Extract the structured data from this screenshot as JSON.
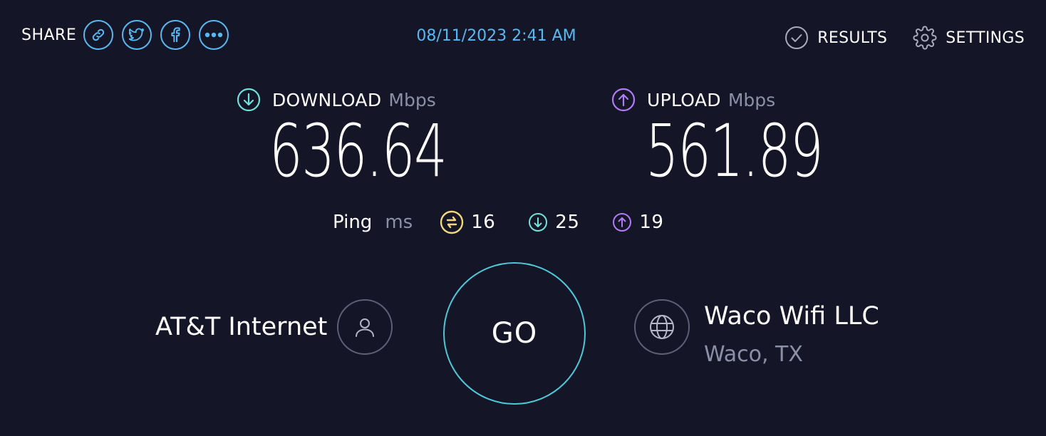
{
  "header": {
    "share_label": "SHARE",
    "share_buttons": [
      {
        "icon": "link-icon"
      },
      {
        "icon": "twitter-icon"
      },
      {
        "icon": "facebook-icon"
      },
      {
        "icon": "more-icon"
      }
    ],
    "timestamp": "08/11/2023 2:41 AM",
    "results_label": "RESULTS",
    "settings_label": "SETTINGS"
  },
  "download": {
    "label": "DOWNLOAD",
    "unit": "Mbps",
    "value": "636.64",
    "icon": "download-arrow-icon",
    "color": "#6fe3d9"
  },
  "upload": {
    "label": "UPLOAD",
    "unit": "Mbps",
    "value": "561.89",
    "icon": "upload-arrow-icon",
    "color": "#b07cf4"
  },
  "ping": {
    "label": "Ping",
    "unit": "ms",
    "idle": {
      "value": "16",
      "icon": "idle-latency-icon",
      "color": "#f3d77c"
    },
    "download": {
      "value": "25",
      "icon": "download-latency-icon",
      "color": "#6fe3d9"
    },
    "upload": {
      "value": "19",
      "icon": "upload-latency-icon",
      "color": "#b07cf4"
    }
  },
  "isp": {
    "name": "AT&T Internet",
    "icon": "user-icon"
  },
  "go_button": {
    "label": "GO"
  },
  "server": {
    "name": "Waco Wifi LLC",
    "location": "Waco, TX",
    "icon": "globe-icon"
  },
  "colors": {
    "background": "#141526",
    "accent_blue": "#58b9f2",
    "go_ring": "#4ec9d9",
    "muted_text": "#8d8fa7"
  }
}
